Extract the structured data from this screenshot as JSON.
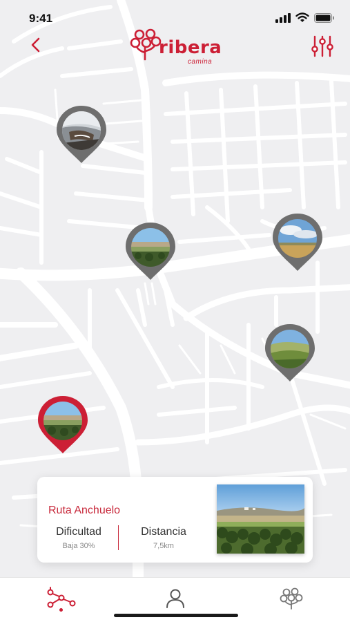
{
  "status_bar": {
    "time": "9:41"
  },
  "header": {
    "brand": "ribera",
    "brand_sub": "camina"
  },
  "map": {
    "pins": [
      {
        "name": "pin-river",
        "selected": false,
        "photo": "river"
      },
      {
        "name": "pin-field-1",
        "selected": false,
        "photo": "field"
      },
      {
        "name": "pin-sky",
        "selected": false,
        "photo": "sky"
      },
      {
        "name": "pin-hills",
        "selected": false,
        "photo": "hills"
      },
      {
        "name": "pin-anchuelo",
        "selected": true,
        "photo": "field"
      }
    ]
  },
  "route_card": {
    "title": "Ruta Anchuelo",
    "difficulty_label": "Dificultad",
    "difficulty_value": "Baja 30%",
    "distance_label": "Distancia",
    "distance_value": "7,5km"
  },
  "tabbar": {
    "tabs": [
      {
        "icon": "route-icon",
        "active": true
      },
      {
        "icon": "user-icon",
        "active": false
      },
      {
        "icon": "tree-icon",
        "active": false
      }
    ]
  },
  "colors": {
    "brand_red": "#cc1f35",
    "pin_gray": "#6e6e6e",
    "map_bg": "#efeff1",
    "street": "#ffffff"
  }
}
